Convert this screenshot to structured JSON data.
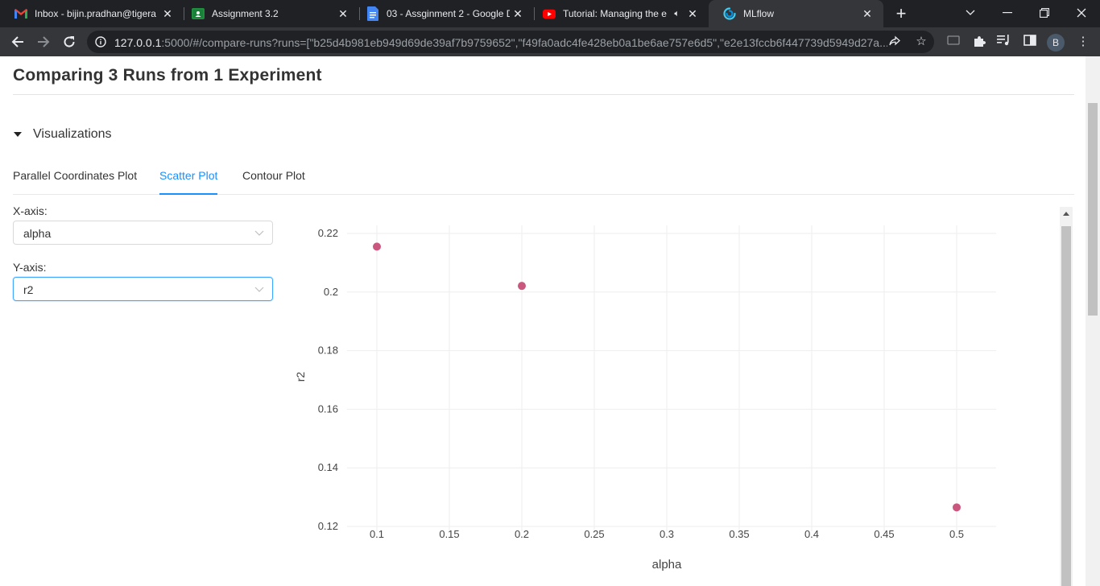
{
  "browser": {
    "tabs": [
      {
        "title": "Inbox - bijin.pradhan@tigera",
        "icon": "gmail-icon",
        "active": false
      },
      {
        "title": "Assignment 3.2",
        "icon": "classroom-icon",
        "active": false
      },
      {
        "title": "03 - Assginment 2 - Google D",
        "icon": "docs-icon",
        "active": false
      },
      {
        "title": "Tutorial: Managing the e",
        "icon": "youtube-icon",
        "active": false,
        "audio": true
      },
      {
        "title": "MLflow",
        "icon": "mlflow-icon",
        "active": true
      }
    ],
    "url_host": "127.0.0.1",
    "url_rest": ":5000/#/compare-runs?runs=[\"b25d4b981eb949d69de39af7b9759652\",\"f49fa0adc4fe428eb0a1be6ae757e6d5\",\"e2e13fccb6f447739d5949d27a...",
    "profile_initial": "B"
  },
  "page": {
    "title": "Comparing 3 Runs from 1 Experiment",
    "section": "Visualizations",
    "tabs": [
      "Parallel Coordinates Plot",
      "Scatter Plot",
      "Contour Plot"
    ],
    "active_tab": "Scatter Plot",
    "x_axis_label": "X-axis:",
    "x_axis_value": "alpha",
    "y_axis_label": "Y-axis:",
    "y_axis_value": "r2"
  },
  "colors": {
    "accent": "#1890ff",
    "marker": "#c9577e"
  },
  "chart_data": {
    "type": "scatter",
    "xlabel": "alpha",
    "ylabel": "r2",
    "x": [
      0.1,
      0.2,
      0.5
    ],
    "y": [
      0.2155,
      0.2021,
      0.1265
    ],
    "xlim": [
      0.1,
      0.5
    ],
    "ylim": [
      0.12,
      0.22
    ],
    "x_ticks": [
      "0.1",
      "0.15",
      "0.2",
      "0.25",
      "0.3",
      "0.35",
      "0.4",
      "0.45",
      "0.5"
    ],
    "y_ticks": [
      "0.12",
      "0.14",
      "0.16",
      "0.18",
      "0.2",
      "0.22"
    ],
    "grid": true
  }
}
